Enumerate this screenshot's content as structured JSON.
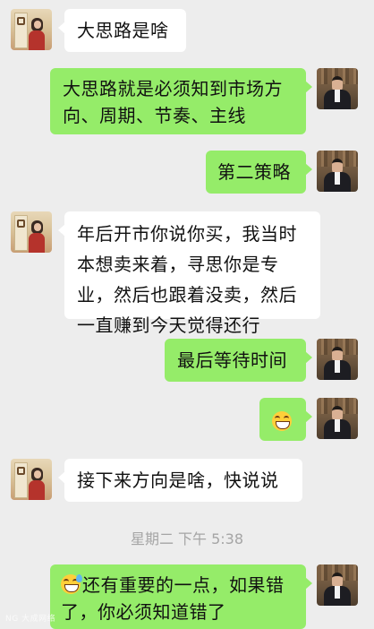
{
  "messages": [
    {
      "side": "left",
      "text": "大思路是啥"
    },
    {
      "side": "right",
      "text": "大思路就是必须知到市场方向、周期、节奏、主线"
    },
    {
      "side": "right",
      "text": "第二策略"
    },
    {
      "side": "left",
      "text": "年后开市你说你买，我当时本想卖来着，寻思你是专业，然后也跟着没卖，然后一直赚到今天觉得还行"
    },
    {
      "side": "right",
      "text": "最后等待时间"
    },
    {
      "side": "right",
      "emoji": "grinning-face-emoji"
    },
    {
      "side": "left",
      "text": "接下来方向是啥，快说说"
    },
    {
      "side": "right",
      "emoji": "sweat-smile-emoji",
      "text": "还有重要的一点，如果错了，你必须知道错了"
    }
  ],
  "timestamp": "星期二 下午 5:38",
  "watermark": "NG 大成网络",
  "colors": {
    "background": "#ededed",
    "incoming_bubble": "#ffffff",
    "outgoing_bubble": "#95ec69",
    "timestamp": "#a5a5a5"
  }
}
